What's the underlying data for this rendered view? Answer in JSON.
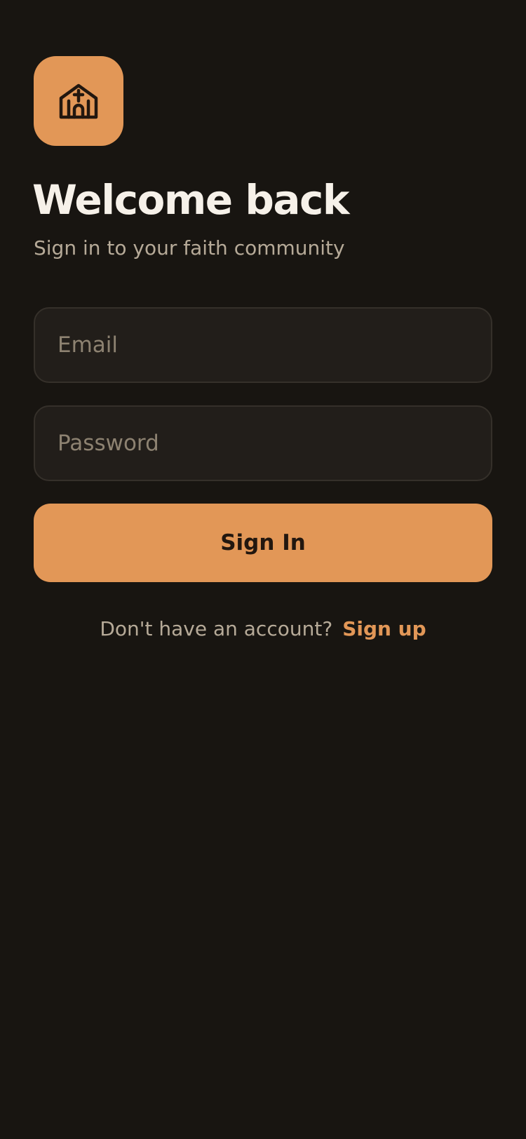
{
  "app": {
    "logo_icon": "church-icon",
    "accent_color": "#e29757",
    "background_color": "#181511"
  },
  "header": {
    "title": "Welcome back",
    "subtitle": "Sign in to your faith community"
  },
  "form": {
    "email_placeholder": "Email",
    "email_value": "",
    "password_placeholder": "Password",
    "password_value": "",
    "submit_label": "Sign In"
  },
  "footer": {
    "prompt": "Don't have an account?",
    "signup_label": "Sign up"
  }
}
